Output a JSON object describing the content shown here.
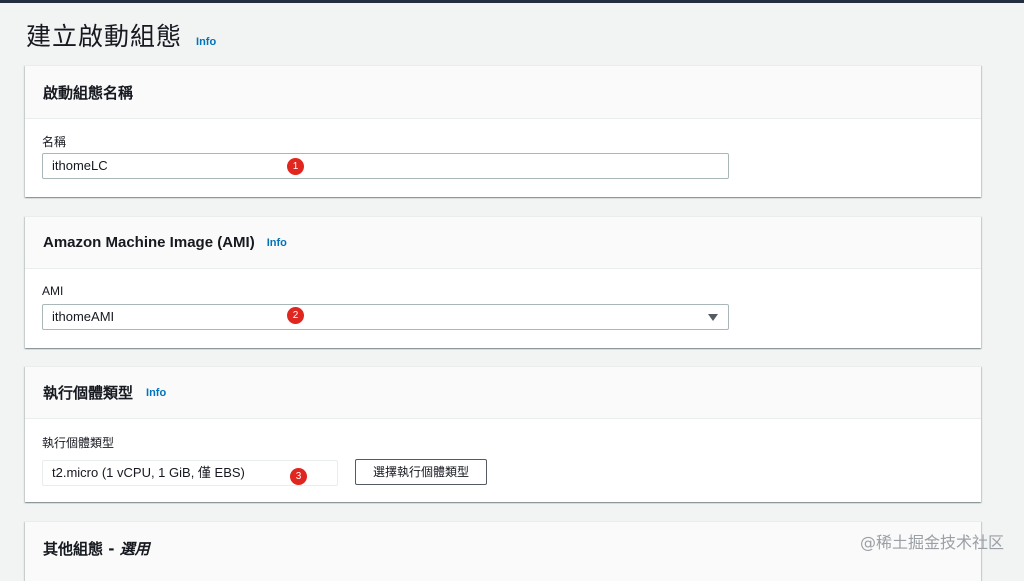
{
  "page": {
    "title": "建立啟動組態",
    "info": "Info"
  },
  "name_section": {
    "title": "啟動組態名稱",
    "label": "名稱",
    "value": "ithomeLC",
    "badge": "1"
  },
  "ami_section": {
    "title": "Amazon Machine Image (AMI)",
    "info": "Info",
    "label": "AMI",
    "value": "ithomeAMI",
    "badge": "2"
  },
  "instance_section": {
    "title": "執行個體類型",
    "info": "Info",
    "label": "執行個體類型",
    "value": "t2.micro (1 vCPU, 1 GiB, 僅 EBS)",
    "badge": "3",
    "choose_button": "選擇執行個體類型"
  },
  "other_section": {
    "title": "其他組態 - ",
    "title_optional": "選用"
  },
  "watermark": "@稀土掘金技术社区"
}
